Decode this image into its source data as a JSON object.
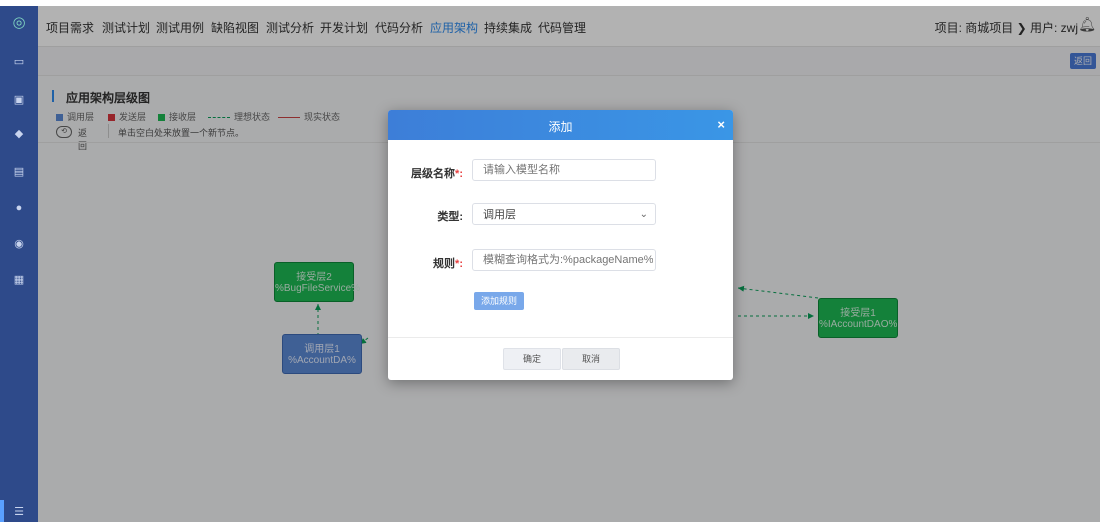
{
  "nav": {
    "items": [
      "项目需求",
      "测试计划",
      "测试用例",
      "缺陷视图",
      "测试分析",
      "开发计划",
      "代码分析",
      "应用架构",
      "持续集成",
      "代码管理"
    ],
    "active": "应用架构",
    "project_user": "项目: 商城项目 ❯ 用户: zwj"
  },
  "subbar": {
    "back": "返回"
  },
  "panel": {
    "title": "应用架构层级图",
    "legend": {
      "call_layer": "调用层",
      "send_layer": "发送层",
      "recv_layer": "接收层",
      "ideal_state": "理想状态",
      "real_state": "现实状态"
    },
    "toolbar": {
      "back": "返回",
      "hint": "单击空白处来放置一个新节点。"
    }
  },
  "nodes": {
    "recv2": {
      "name": "接受层2",
      "pattern": "%BugFileService%"
    },
    "call1": {
      "name": "调用层1",
      "pattern": "%AccountDA%"
    },
    "recv1": {
      "name": "接受层1",
      "pattern": "%IAccountDAO%"
    }
  },
  "modal": {
    "title": "添加",
    "close": "×",
    "fields": {
      "level_name": {
        "label": "层级名称",
        "placeholder": "请输入模型名称"
      },
      "type": {
        "label": "类型:",
        "value": "调用层"
      },
      "rule": {
        "label": "规则",
        "placeholder": "模糊查询格式为:%packageName%"
      }
    },
    "required_mark": "*:",
    "add_rule": "添加规则",
    "ok": "确定",
    "cancel": "取消"
  },
  "colors": {
    "sidebar": "#2e4a8a",
    "accent": "#2d8cf0",
    "node_green": "#1db954",
    "node_blue": "#5b8ad6",
    "send_red": "#d9363e",
    "edge_green": "#0aa05a"
  },
  "icons": [
    "logo-icon",
    "monitor-icon",
    "project-icon",
    "layers-icon",
    "server-icon",
    "clock-icon",
    "database-icon",
    "report-icon",
    "menu-icon",
    "bell-icon",
    "close-icon",
    "chevron-down-icon",
    "back-icon"
  ]
}
